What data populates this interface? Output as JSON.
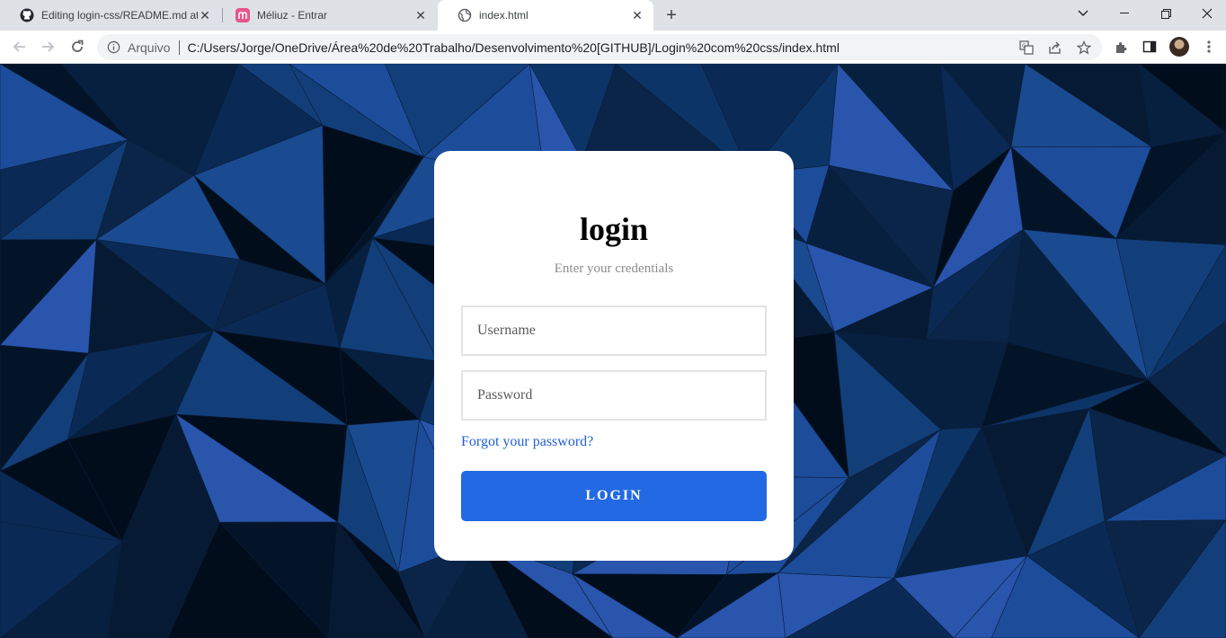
{
  "browser": {
    "tabs": [
      {
        "title": "Editing login-css/README.md at",
        "icon": "github-icon",
        "active": false
      },
      {
        "title": "Méliuz - Entrar",
        "icon": "meliuz-icon",
        "active": false
      },
      {
        "title": "index.html",
        "icon": "globe-icon",
        "active": true
      }
    ],
    "omnibox": {
      "security_label": "Arquivo",
      "url": "C:/Users/Jorge/OneDrive/Área%20de%20Trabalho/Desenvolvimento%20[GITHUB]/Login%20com%20css/index.html"
    }
  },
  "login": {
    "title": "login",
    "subtitle": "Enter your credentials",
    "username_placeholder": "Username",
    "password_placeholder": "Password",
    "forgot_label": "Forgot your password?",
    "button_label": "LOGIN"
  },
  "colors": {
    "accent": "#2269e3",
    "link": "#1f5fd6",
    "background_dark": "#0b2548"
  }
}
